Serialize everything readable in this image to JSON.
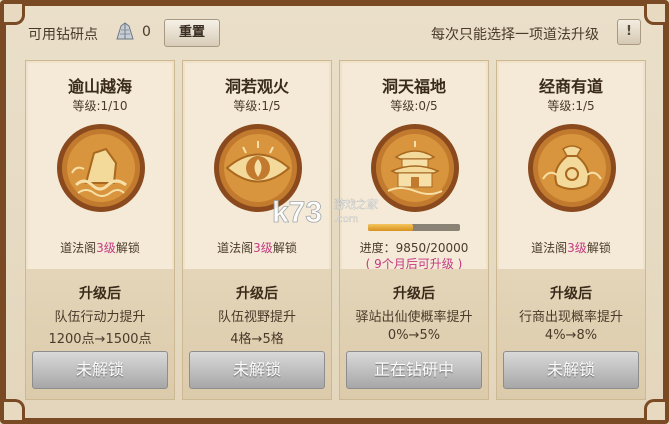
{
  "header": {
    "points_label": "可用钻研点",
    "points_value": "0",
    "reset_label": "重置",
    "hint": "每次只能选择一项道法升级",
    "info_label": "!"
  },
  "cards": [
    {
      "title": "逾山越海",
      "level": "等级:1/10",
      "unlock_prefix": "道法阁",
      "unlock_level": "3级",
      "unlock_suffix": "解锁",
      "after_title": "升级后",
      "after_desc": "队伍行动力提升",
      "after_change": "1200点→1500点",
      "button": "未解锁",
      "icon": "mountain-wave-icon"
    },
    {
      "title": "洞若观火",
      "level": "等级:1/5",
      "unlock_prefix": "道法阁",
      "unlock_level": "3级",
      "unlock_suffix": "解锁",
      "after_title": "升级后",
      "after_desc": "队伍视野提升",
      "after_change": "4格→5格",
      "button": "未解锁",
      "icon": "fire-eye-icon"
    },
    {
      "title": "洞天福地",
      "level": "等级:0/5",
      "progress_text": "进度：9850/20000",
      "progress_time": "( 9个月后可升级 )",
      "progress_fraction": 0.4925,
      "after_title": "升级后",
      "after_desc": "驿站出仙使概率提升",
      "after_change": "0%→5%",
      "button": "正在钻研中",
      "icon": "pavilion-icon"
    },
    {
      "title": "经商有道",
      "level": "等级:1/5",
      "unlock_prefix": "道法阁",
      "unlock_level": "3级",
      "unlock_suffix": "解锁",
      "after_title": "升级后",
      "after_desc": "行商出现概率提升",
      "after_change": "4%→8%",
      "button": "未解锁",
      "icon": "money-bag-icon"
    }
  ],
  "watermark": {
    "logo": "k73",
    "text": "游戏之家",
    "url": ".com"
  }
}
